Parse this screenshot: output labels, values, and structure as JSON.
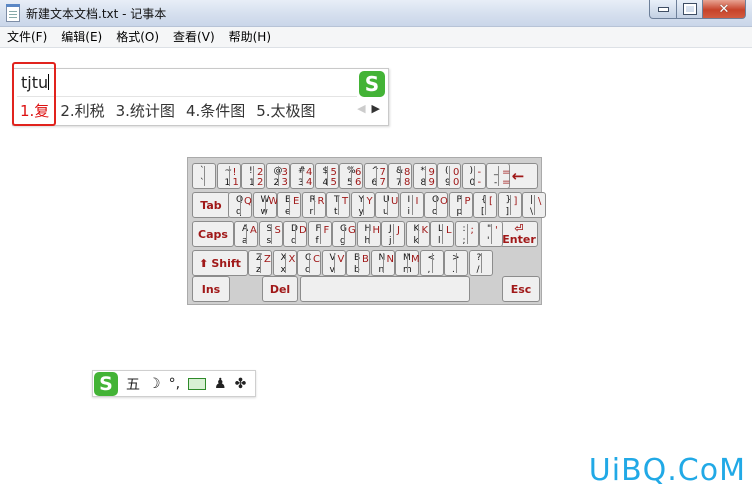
{
  "window": {
    "title": "新建文本文档.txt - 记事本",
    "controls": {
      "min": "",
      "max": "",
      "close": "✕"
    }
  },
  "menu": [
    {
      "label": "文件(F)"
    },
    {
      "label": "编辑(E)"
    },
    {
      "label": "格式(O)"
    },
    {
      "label": "查看(V)"
    },
    {
      "label": "帮助(H)"
    }
  ],
  "ime": {
    "composition": "tjtu",
    "logo": "S",
    "candidates": [
      "1.复",
      "2.利税",
      "3.统计图",
      "4.条件图",
      "5.太极图"
    ],
    "prev_arrow": "◀",
    "next_arrow": "▶"
  },
  "keyboard": {
    "row1": [
      {
        "u": "`",
        "l": "`",
        "r": "",
        "r2": ""
      },
      {
        "u": "~",
        "l": "1",
        "r": "!",
        "r2": "1"
      },
      {
        "u": "!",
        "l": "1",
        "r": "2",
        "r2": "2"
      },
      {
        "u": "@",
        "l": "2",
        "r": "3",
        "r2": "3"
      },
      {
        "u": "#",
        "l": "3",
        "r": "4",
        "r2": "4"
      },
      {
        "u": "$",
        "l": "4",
        "r": "5",
        "r2": "5"
      },
      {
        "u": "%",
        "l": "5",
        "r": "6",
        "r2": "6"
      },
      {
        "u": "^",
        "l": "6",
        "r": "7",
        "r2": "7"
      },
      {
        "u": "&",
        "l": "7",
        "r": "8",
        "r2": "8"
      },
      {
        "u": "*",
        "l": "8",
        "r": "9",
        "r2": "9"
      },
      {
        "u": "(",
        "l": "9",
        "r": "0",
        "r2": "0"
      },
      {
        "u": ")",
        "l": "0",
        "r": "-",
        "r2": "-"
      },
      {
        "u": "_",
        "l": "-",
        "r": "=",
        "r2": "="
      }
    ],
    "row2": [
      {
        "u": "Q",
        "l": "q",
        "r": "Q",
        "r2": ""
      },
      {
        "u": "W",
        "l": "w",
        "r": "W",
        "r2": ""
      },
      {
        "u": "E",
        "l": "e",
        "r": "E",
        "r2": ""
      },
      {
        "u": "R",
        "l": "r",
        "r": "R",
        "r2": ""
      },
      {
        "u": "T",
        "l": "t",
        "r": "T",
        "r2": ""
      },
      {
        "u": "Y",
        "l": "y",
        "r": "Y",
        "r2": ""
      },
      {
        "u": "U",
        "l": "u",
        "r": "U",
        "r2": ""
      },
      {
        "u": "I",
        "l": "i",
        "r": "I",
        "r2": ""
      },
      {
        "u": "O",
        "l": "o",
        "r": "O",
        "r2": ""
      },
      {
        "u": "P",
        "l": "p",
        "r": "P",
        "r2": ""
      },
      {
        "u": "{",
        "l": "[",
        "r": "[",
        "r2": ""
      },
      {
        "u": "}",
        "l": "]",
        "r": "]",
        "r2": ""
      },
      {
        "u": "|",
        "l": "\\",
        "r": "\\",
        "r2": ""
      }
    ],
    "row3": [
      {
        "u": "A",
        "l": "a",
        "r": "A",
        "r2": ""
      },
      {
        "u": "S",
        "l": "s",
        "r": "S",
        "r2": ""
      },
      {
        "u": "D",
        "l": "d",
        "r": "D",
        "r2": ""
      },
      {
        "u": "F",
        "l": "f",
        "r": "F",
        "r2": ""
      },
      {
        "u": "G",
        "l": "g",
        "r": "G",
        "r2": ""
      },
      {
        "u": "H",
        "l": "h",
        "r": "H",
        "r2": ""
      },
      {
        "u": "J",
        "l": "j",
        "r": "J",
        "r2": ""
      },
      {
        "u": "K",
        "l": "k",
        "r": "K",
        "r2": ""
      },
      {
        "u": "L",
        "l": "l",
        "r": "L",
        "r2": ""
      },
      {
        "u": ":",
        "l": ";",
        "r": ";",
        "r2": ""
      },
      {
        "u": "\"",
        "l": "'",
        "r": "'",
        "r2": ""
      }
    ],
    "row4": [
      {
        "u": "Z",
        "l": "z",
        "r": "Z",
        "r2": ""
      },
      {
        "u": "X",
        "l": "x",
        "r": "X",
        "r2": ""
      },
      {
        "u": "C",
        "l": "c",
        "r": "C",
        "r2": ""
      },
      {
        "u": "V",
        "l": "v",
        "r": "V",
        "r2": ""
      },
      {
        "u": "B",
        "l": "b",
        "r": "B",
        "r2": ""
      },
      {
        "u": "N",
        "l": "n",
        "r": "N",
        "r2": ""
      },
      {
        "u": "M",
        "l": "m",
        "r": "M",
        "r2": ""
      },
      {
        "u": "<",
        "l": ",",
        "r": "",
        "r2": ""
      },
      {
        "u": ">",
        "l": ".",
        "r": "",
        "r2": ""
      },
      {
        "u": "?",
        "l": "/",
        "r": "",
        "r2": ""
      }
    ],
    "tab": "Tab",
    "caps": "Caps",
    "shift": "Shift",
    "enter": "Enter",
    "ins": "Ins",
    "del": "Del",
    "esc": "Esc",
    "backspace_arrow": "←"
  },
  "status_bar": {
    "logo": "S",
    "mode": "五",
    "half_full": "☽",
    "punct": "°,",
    "person": "♟",
    "tools": "✤"
  },
  "watermark": "UiBQ.CoM"
}
